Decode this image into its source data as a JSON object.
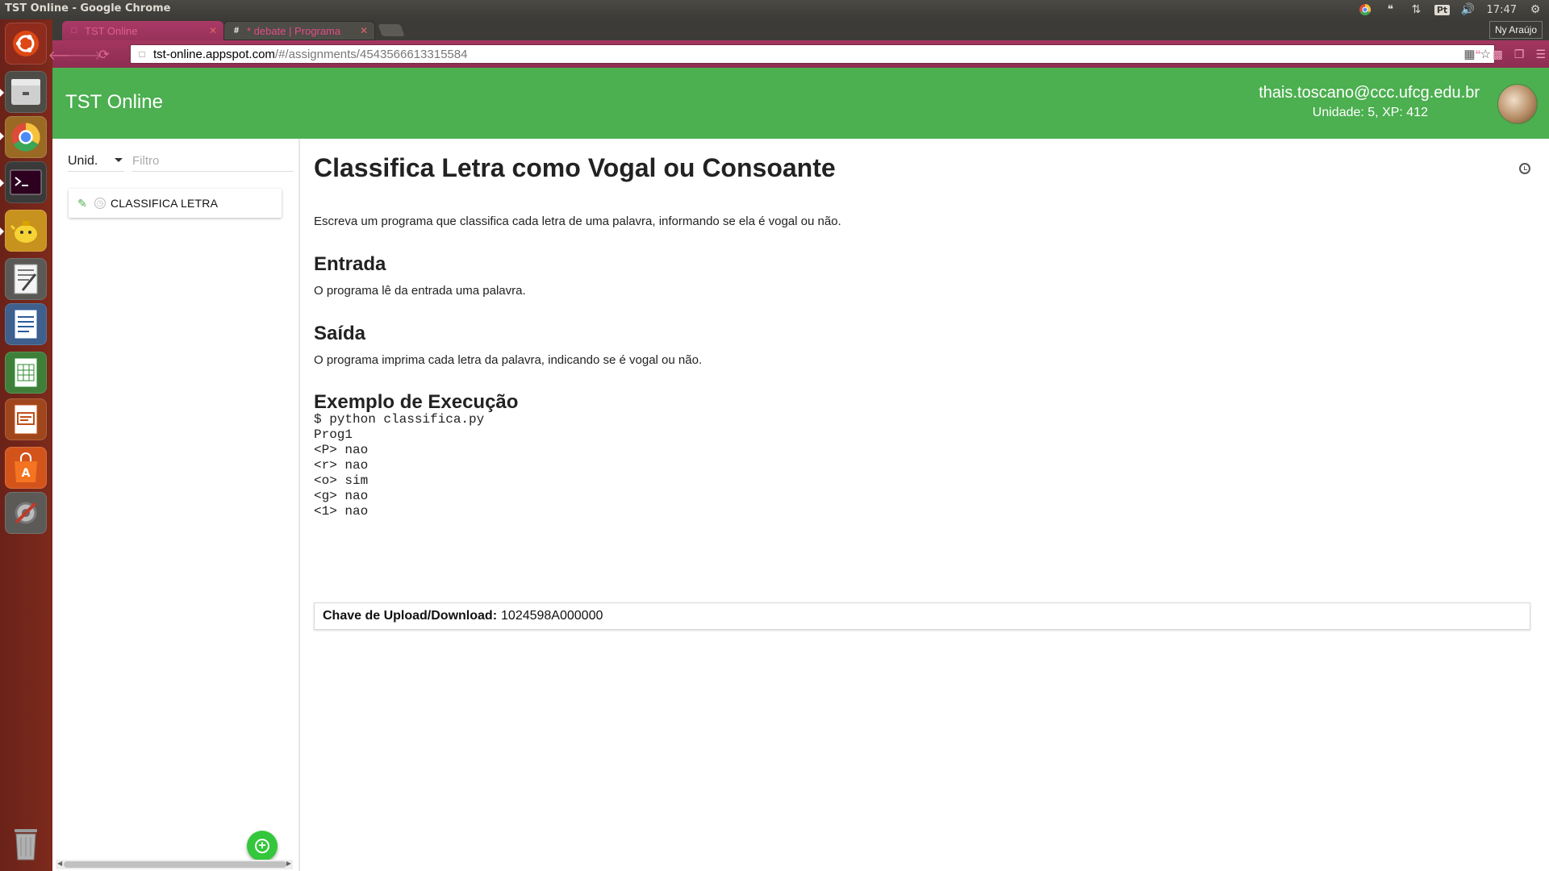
{
  "system": {
    "window_title": "TST Online - Google Chrome",
    "clock": "17:47",
    "keyboard_layout": "Pt"
  },
  "browser": {
    "tabs": [
      {
        "label": "TST Online",
        "active": true
      },
      {
        "label": "* debate | Programa",
        "favicon_text": "#",
        "active": false
      }
    ],
    "profile_name": "Ny Araújo",
    "url_host": "tst-online.appspot.com",
    "url_path": "/#/assignments/4543566613315584"
  },
  "app": {
    "title": "TST Online",
    "user_email": "thais.toscano@ccc.ufcg.edu.br",
    "user_stats": "Unidade: 5, XP: 412",
    "colors": {
      "appbar": "#4caf50",
      "fab": "#34c73b",
      "browser_accent": "#9b335b"
    }
  },
  "sidebar": {
    "unit_select_value": "Unid.",
    "filter_placeholder": "Filtro",
    "assignments": [
      {
        "label": "CLASSIFICA LETRA",
        "icon": "pencil-icon",
        "status_icon": "clock-icon"
      }
    ]
  },
  "assignment": {
    "title": "Classifica Letra como Vogal ou Consoante",
    "description": "Escreva um programa que classifica cada letra de uma palavra, informando se ela é vogal ou não.",
    "input_heading": "Entrada",
    "input_text": "O programa lê da entrada uma palavra.",
    "output_heading": "Saída",
    "output_text": "O programa imprima cada letra da palavra, indicando se é vogal ou não.",
    "example_heading": "Exemplo de Execução",
    "example_code": "$ python classifica.py\nProg1\n<P> nao\n<r> nao\n<o> sim\n<g> nao\n<1> nao",
    "upload_key_label": "Chave de Upload/Download:",
    "upload_key_value": "1024598A000000"
  }
}
